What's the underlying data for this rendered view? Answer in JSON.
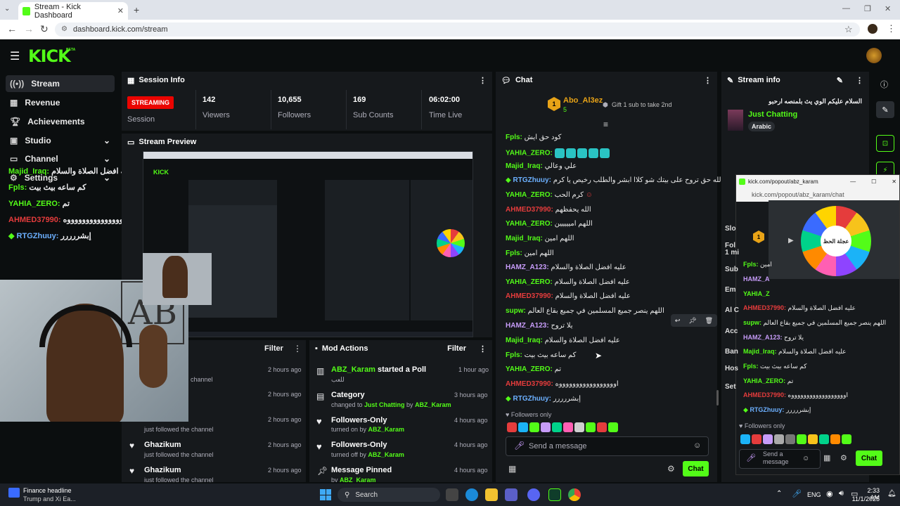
{
  "browser": {
    "tab_title": "Stream - Kick Dashboard",
    "url": "dashboard.kick.com/stream"
  },
  "header": {
    "logo": "KICK",
    "beta": "BETA"
  },
  "sidebar": {
    "items": [
      {
        "label": "Stream"
      },
      {
        "label": "Revenue"
      },
      {
        "label": "Achievements"
      },
      {
        "label": "Studio"
      },
      {
        "label": "Channel"
      },
      {
        "label": "Settings"
      }
    ]
  },
  "overlay_chat": [
    {
      "user": "Majid_Iraq:",
      "text": "عليه افضل الصلاة والسلام"
    },
    {
      "user": "Fpls:",
      "text": "كم ساعه بيث بيت"
    },
    {
      "user": "YAHIA_ZERO:",
      "text": "تم"
    },
    {
      "user": "AHMED37990:",
      "text": "اوووووووووووووووووه"
    },
    {
      "user": "RTGZhuuy:",
      "text": "إبشررررر"
    }
  ],
  "session": {
    "title": "Session Info",
    "status": "STREAMING",
    "status_label": "Session",
    "stats": [
      {
        "value": "142",
        "label": "Viewers"
      },
      {
        "value": "10,655",
        "label": "Followers"
      },
      {
        "value": "169",
        "label": "Sub Counts"
      },
      {
        "value": "06:02:00",
        "label": "Time Live"
      }
    ]
  },
  "preview": {
    "title": "Stream Preview"
  },
  "activity": {
    "filter": "Filter",
    "rows": [
      {
        "time": "2 hours ago",
        "sub": "channel"
      },
      {
        "time": "2 hours ago",
        "sub": ""
      },
      {
        "time": "2 hours ago",
        "sub": "just followed the channel"
      },
      {
        "user": "Ghazikum",
        "time": "2 hours ago",
        "sub": "just followed the channel"
      },
      {
        "user": "Ghazikum",
        "time": "2 hours ago",
        "sub": "just followed the channel"
      }
    ]
  },
  "mod_actions": {
    "title": "Mod Actions",
    "filter": "Filter",
    "rows": [
      {
        "title_user": "ABZ_Karam",
        "title_rest": " started a Poll",
        "sub": "للعب",
        "time": "1 hour ago"
      },
      {
        "title": "Category",
        "sub_pre": "changed to ",
        "sub_hl": "Just Chatting",
        "sub_mid": " by ",
        "sub_user": "ABZ_Karam",
        "time": "3 hours ago"
      },
      {
        "title": "Followers-Only",
        "sub_pre": "turned on by ",
        "sub_user": "ABZ_Karam",
        "time": "4 hours ago"
      },
      {
        "title": "Followers-Only",
        "sub_pre": "turned off by ",
        "sub_user": "ABZ_Karam",
        "time": "4 hours ago"
      },
      {
        "title": "Message Pinned",
        "sub_pre": "by ",
        "sub_user": "ABZ_Karam",
        "time": "4 hours ago"
      }
    ]
  },
  "chat": {
    "title": "Chat",
    "top_gifter": {
      "name": "Abo_Al3ez",
      "rank": "1",
      "count": "5"
    },
    "gift_text": "Gift 1 sub to take 2nd",
    "messages": [
      {
        "user": "Fpls:",
        "text": "كود حق ايش",
        "color": "g"
      },
      {
        "user": "YAHIA_ZERO:",
        "text": "",
        "color": "g"
      },
      {
        "user": "Majid_Iraq:",
        "text": "علي وعالي",
        "color": "g"
      },
      {
        "user": "RTGZhuuy:",
        "text": "و الله حق تروح على بيتك شو كلاا ابشر والطلب رخيص يا كرم",
        "color": "b"
      },
      {
        "user": "YAHIA_ZERO:",
        "text": "كرم الحب",
        "color": "g"
      },
      {
        "user": "AHMED37990:",
        "text": "الله يحفظهم",
        "color": "r"
      },
      {
        "user": "YAHIA_ZERO:",
        "text": "اللهم امييييين",
        "color": "g"
      },
      {
        "user": "Majid_Iraq:",
        "text": "اللهم امين",
        "color": "g"
      },
      {
        "user": "Fpls:",
        "text": "اللهم امين",
        "color": "g"
      },
      {
        "user": "HAMZ_A123:",
        "text": "عليه افضل الصلاة والسلام",
        "color": "p"
      },
      {
        "user": "YAHIA_ZERO:",
        "text": "عليه افضل الصلاة والسلام",
        "color": "g"
      },
      {
        "user": "AHMED37990:",
        "text": "عليه افضل الصلاة والسلام",
        "color": "r"
      },
      {
        "user": "supw:",
        "text": "اللهم ينصر جميع المسلمين في جميع بقاع العالم",
        "color": "g"
      },
      {
        "user": "HAMZ_A123:",
        "text": "يلا تروح",
        "color": "p"
      },
      {
        "user": "Majid_Iraq:",
        "text": "عليه افضل الصلاة والسلام",
        "color": "g"
      },
      {
        "user": "Fpls:",
        "text": "كم ساعه بيث بيت",
        "color": "g"
      },
      {
        "user": "YAHIA_ZERO:",
        "text": "تم",
        "color": "g"
      },
      {
        "user": "AHMED37990:",
        "text": "اوووووووووووووووووه",
        "color": "r"
      },
      {
        "user": "RTGZhuuy:",
        "text": "إبشررررر",
        "color": "b"
      }
    ],
    "followers_only": "Followers only",
    "input_placeholder": "Send a message",
    "send": "Chat"
  },
  "stream_info": {
    "title": "Stream info",
    "stream_title": "السلام عليكم الوي يث بلمنصه ارحبو",
    "category": "Just Chatting",
    "tag": "Arabic"
  },
  "popout": {
    "url_title": "kick.com/popout/abz_karam/chat",
    "url": "kick.com/popout/abz_karam/chat",
    "wheel_label": "عجلة الحظ",
    "labels": [
      "Slo",
      "Fol",
      "1 mi",
      "Sub",
      "Em",
      "Al C",
      "Acc",
      "Ban",
      "Hos",
      "Set"
    ],
    "messages": [
      {
        "user": "Fpls:",
        "text": "امين",
        "color": "g"
      },
      {
        "user": "HAMZ_A",
        "text": "",
        "color": "p"
      },
      {
        "user": "YAHIA_Z",
        "text": "",
        "color": "g"
      },
      {
        "user": "AHMED37990:",
        "text": "عليه افضل الصلاة والسلام",
        "color": "r"
      },
      {
        "user": "supw:",
        "text": "اللهم ينصر جميع المسلمين في جميع بقاع العالم",
        "color": "g"
      },
      {
        "user": "HAMZ_A123:",
        "text": "يلا تروح",
        "color": "p"
      },
      {
        "user": "Majid_Iraq:",
        "text": "عليه افضل الصلاة والسلام",
        "color": "g"
      },
      {
        "user": "Fpls:",
        "text": "كم ساعه بيث بيت",
        "color": "g"
      },
      {
        "user": "YAHIA_ZERO:",
        "text": "تم",
        "color": "g"
      },
      {
        "user": "AHMED37990:",
        "text": "اووووووووووووووووووه",
        "color": "r"
      },
      {
        "user": "RTGZhuuy:",
        "text": "إبشررررر",
        "color": "b"
      }
    ],
    "followers_only": "Followers only",
    "input_placeholder": "Send a message",
    "send": "Chat"
  },
  "taskbar": {
    "news_title": "Finance headline",
    "news_sub": "Trump and Xi Ea...",
    "search": "Search",
    "lang": "ENG",
    "time": "2:33 AM",
    "date": "11/1/2025"
  }
}
